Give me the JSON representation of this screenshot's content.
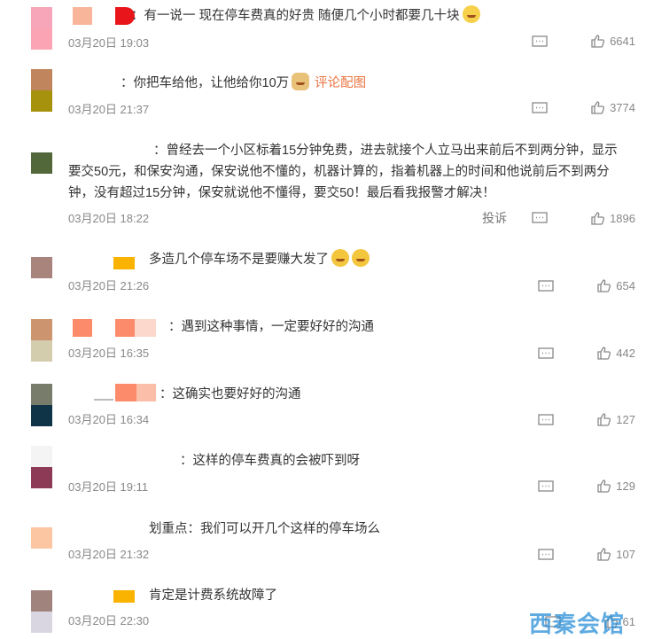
{
  "comments": [
    {
      "text": "：有一说一 现在停车费真的好贵 随便几个小时都要几十块",
      "date": "03月20日 19:03",
      "likes": "6641",
      "avatar_colors": [
        "#f6a6b8",
        "#fba4b4"
      ],
      "name_colors": [
        "#f8b59a",
        "#e8161b"
      ],
      "emoji": "thinking-emoji"
    },
    {
      "text": "：你把车给他，让他给你10万",
      "pic_link": "评论配图",
      "date": "03月20日 21:37",
      "likes": "3774",
      "avatar_colors": [
        "#c0855d",
        "#a6920c"
      ],
      "emoji": "doge-emoji"
    },
    {
      "text": "：曾经去一个小区标着15分钟免费，进去就接个人立马出来前后不到两分钟，显示要交50元，和保安沟通，保安说他不懂的，机器计算的，指着机器上的时间和他说前后不到两分钟，没有超过15分钟，保安就说他不懂得，要交50！最后看我报警才解决！",
      "date": "03月20日 18:22",
      "likes": "1896",
      "report": "投诉",
      "avatar_colors": [
        "#52673a",
        "#52673a"
      ]
    },
    {
      "text": "多造几个停车场不是要赚大发了",
      "date": "03月20日 21:26",
      "likes": "654",
      "avatar_colors": [
        "#a8847d",
        "#ffffff"
      ],
      "name_colors": [
        "#f9b300"
      ],
      "emoji": "laugh-cry-emoji"
    },
    {
      "text": "：遇到这种事情，一定要好好的沟通",
      "date": "03月20日 16:35",
      "likes": "442",
      "avatar_colors": [
        "#cc946f",
        "#d3ccad"
      ],
      "name_colors": [
        "#fb8b6b",
        "#fb8b6b",
        "#fbd7cc"
      ]
    },
    {
      "text": "：这确实也要好好的沟通",
      "date": "03月20日 16:34",
      "likes": "127",
      "avatar_colors": [
        "#777c6b",
        "#103447"
      ],
      "name_colors": [
        "#fb8b6b",
        "#fbbfa9"
      ]
    },
    {
      "text": "：这样的停车费真的会被吓到呀",
      "date": "03月20日 19:11",
      "likes": "129",
      "avatar_colors": [
        "#f4f4f4",
        "#8c3a55"
      ]
    },
    {
      "text": "划重点：我们可以开几个这样的停车场么",
      "date": "03月20日 21:32",
      "likes": "107",
      "avatar_colors": [
        "#fcc6a2",
        "#ffffff"
      ]
    },
    {
      "text": "肯定是计费系统故障了",
      "date": "03月20日 22:30",
      "likes": "61",
      "avatar_colors": [
        "#a1837e",
        "#d9d6e2"
      ],
      "name_colors": [
        "#f9b300"
      ]
    }
  ],
  "watermark": "西秦会馆"
}
